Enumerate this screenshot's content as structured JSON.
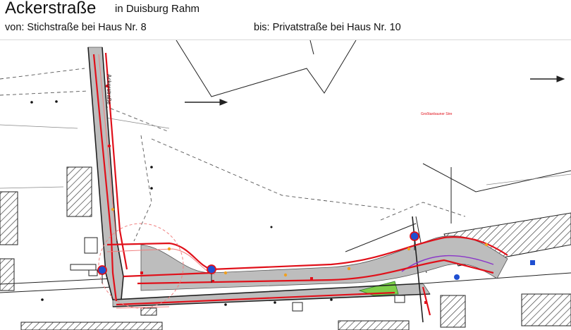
{
  "header": {
    "street_name": "Ackerstraße",
    "district": "in Duisburg Rahm",
    "from": "von: Stichstraße bei Haus Nr. 8",
    "to": "bis: Privatstraße bei Haus Nr. 10"
  },
  "map": {
    "street_label": "Ackerstraße",
    "area_label": "Großtanbauner Stre",
    "colors": {
      "road_fill": "#bdbdbd",
      "construction_outline": "#e0101a",
      "green_area": "#7fcf4a",
      "sign_blue": "#1f4fd1",
      "line_dark": "#222222",
      "purple_line": "#8a35c9"
    },
    "icons": [
      "arrow-right-icon",
      "traffic-sign-icon",
      "hatched-building-icon"
    ]
  }
}
